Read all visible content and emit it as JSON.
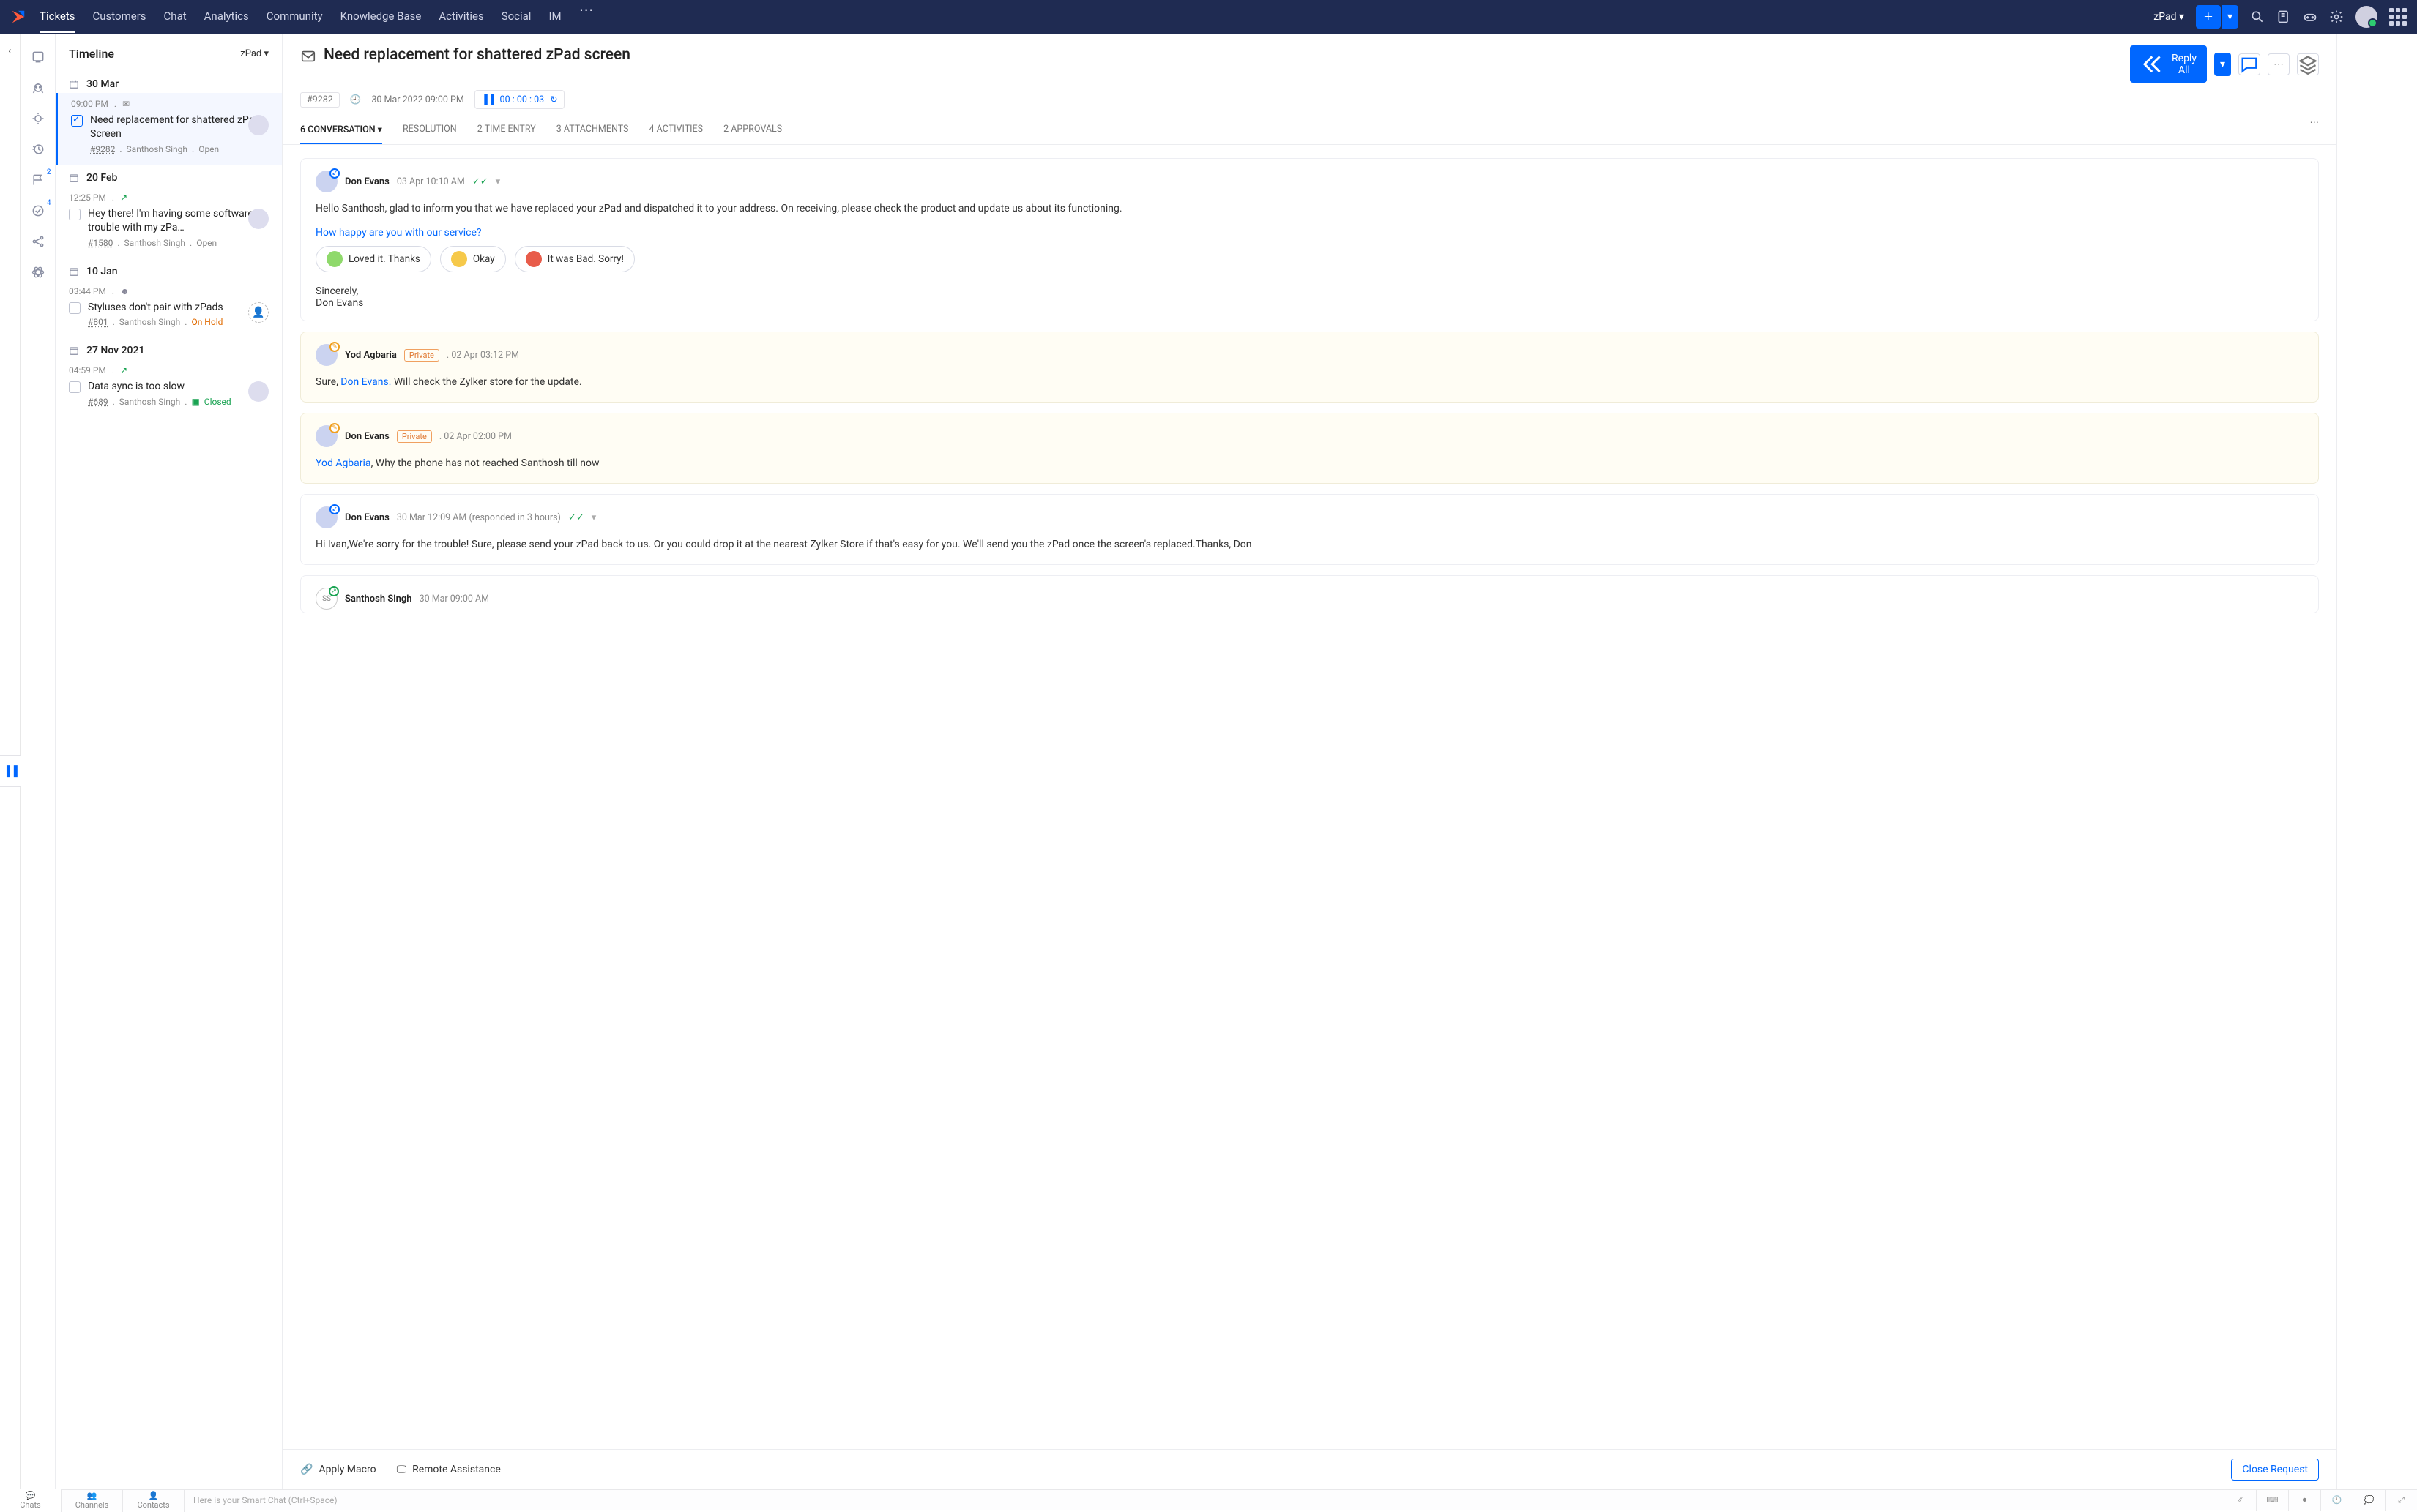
{
  "nav": {
    "items": [
      "Tickets",
      "Customers",
      "Chat",
      "Analytics",
      "Community",
      "Knowledge Base",
      "Activities",
      "Social",
      "IM"
    ],
    "active": 0,
    "department": "zPad"
  },
  "timeline": {
    "title": "Timeline",
    "filter": "zPad",
    "groups": [
      {
        "date": "30 Mar",
        "tickets": [
          {
            "time": "09:00 PM",
            "channel": "email",
            "title": "Need replacement for shattered zPad Screen",
            "id": "#9282",
            "assignee": "Santhosh Singh",
            "status": "Open",
            "status_class": "open",
            "selected": true,
            "avatar": true
          }
        ]
      },
      {
        "date": "20 Feb",
        "tickets": [
          {
            "time": "12:25 PM",
            "channel": "chat",
            "title": "Hey there! I'm having some software trouble with my zPa…",
            "id": "#1580",
            "assignee": "Santhosh Singh",
            "status": "Open",
            "status_class": "open",
            "selected": false,
            "avatar": true
          }
        ]
      },
      {
        "date": "10 Jan",
        "tickets": [
          {
            "time": "03:44 PM",
            "channel": "web",
            "title": "Styluses don't pair with zPads",
            "id": "#801",
            "assignee": "Santhosh Singh",
            "status": "On Hold",
            "status_class": "hold",
            "selected": false,
            "avatar": false
          }
        ]
      },
      {
        "date": "27 Nov 2021",
        "tickets": [
          {
            "time": "04:59 PM",
            "channel": "chat",
            "title": "Data sync is too slow",
            "id": "#689",
            "assignee": "Santhosh Singh",
            "status": "Closed",
            "status_class": "closed",
            "selected": false,
            "avatar": true,
            "closed_icon": true
          }
        ]
      }
    ]
  },
  "ticket": {
    "subject": "Need replacement for shattered zPad screen",
    "id": "#9282",
    "created": "30 Mar 2022 09:00 PM",
    "timer": "00 : 00 : 03",
    "reply_all": "Reply All",
    "tabs": [
      {
        "label": "6 CONVERSATION",
        "active": true
      },
      {
        "label": "RESOLUTION"
      },
      {
        "label": "2 TIME ENTRY"
      },
      {
        "label": "3 ATTACHMENTS"
      },
      {
        "label": "4 ACTIVITIES"
      },
      {
        "label": "2 APPROVALS"
      }
    ],
    "messages": [
      {
        "sender": "Don Evans",
        "date": "03 Apr 10:10 AM",
        "dir": "in",
        "read": true,
        "body": "Hello Santhosh, glad to inform you that we have replaced your zPad and dispatched it to your address. On receiving, please check the product and update us about its functioning.",
        "rating_q": "How happy are you with our service?",
        "ratings": [
          "Loved it. Thanks",
          "Okay",
          "It was Bad. Sorry!"
        ],
        "sig_line1": "Sincerely,",
        "sig_line2": "Don Evans"
      },
      {
        "sender": "Yod Agbaria",
        "date": "02 Apr 03:12 PM",
        "private": true,
        "dir": "out",
        "body_prefix": "Sure, ",
        "mention": "Don Evans.",
        "body_suffix": " Will check the Zylker store for the update."
      },
      {
        "sender": "Don Evans",
        "date": "02 Apr 02:00 PM",
        "private": true,
        "dir": "out",
        "mention": "Yod Agbaria",
        "body_suffix": ",  Why the phone has not reached Santhosh till now"
      },
      {
        "sender": "Don Evans",
        "date": "30 Mar 12:09 AM (responded in 3 hours)",
        "dir": "in",
        "read": true,
        "body": "Hi Ivan,We're sorry for the trouble! Sure, please send your zPad back to us. Or you could drop it at the nearest Zylker Store if that's easy for you. We'll send you the zPad once the screen's replaced.Thanks, Don"
      },
      {
        "sender": "Santhosh Singh",
        "date": "30 Mar 09:00 AM",
        "dir": "up",
        "initials": "SS"
      }
    ],
    "footer": {
      "macro": "Apply Macro",
      "remote": "Remote Assistance",
      "close": "Close Request"
    }
  },
  "bottombar": {
    "tabs": [
      "Chats",
      "Channels",
      "Contacts"
    ],
    "placeholder": "Here is your Smart Chat (Ctrl+Space)"
  }
}
